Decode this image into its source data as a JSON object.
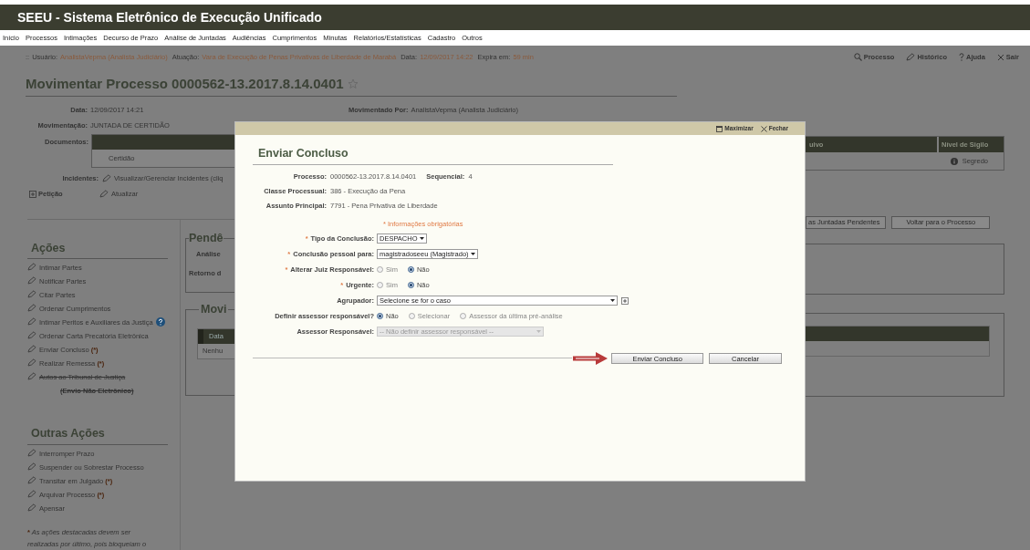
{
  "app_title": "SEEU - Sistema Eletrônico de Execução Unificado",
  "nav_menu": [
    "Início",
    "Processos",
    "Intimações",
    "Decurso de Prazo",
    "Análise de Juntadas",
    "Audiências",
    "Cumprimentos",
    "Minutas",
    "Relatórios/Estatísticas",
    "Cadastro",
    "Outros"
  ],
  "session": {
    "prefix": "::",
    "user_label": "Usuário:",
    "user": "AnalistaVepma (Analista Judiciário)",
    "role_label": "Atuação:",
    "role": "Vara de Execução de Penas Privativas de Liberdade de Marabá",
    "date_label": "Data:",
    "date": "12/09/2017 14:22",
    "expires_label": "Expira em:",
    "expires": "59 min"
  },
  "top_links": [
    {
      "kind": "search",
      "label": "Processo"
    },
    {
      "kind": "pencil",
      "label": "Histórico"
    },
    {
      "kind": "help",
      "label": "Ajuda"
    },
    {
      "kind": "close",
      "label": "Sair"
    }
  ],
  "page_title": "Movimentar Processo 0000562-13.2017.8.14.0401",
  "details": {
    "date_label": "Data:",
    "date": "12/09/2017 14:21",
    "moved_by_label": "Movimentado Por:",
    "moved_by": "AnalistaVepma (Analista Judiciário)",
    "movement_label": "Movimentação:",
    "movement": "JUNTADA DE CERTIDÃO"
  },
  "documents": {
    "label": "Documentos:",
    "rows": [
      "Certidão"
    ],
    "right_headers": [
      "uivo",
      "Nível de Sigilo"
    ],
    "right_rows": [
      "Segredo"
    ]
  },
  "incidents": {
    "label": "Incidentes:",
    "link": "Visualizar/Gerenciar Incidentes (cliq"
  },
  "petition": {
    "label": "Petição",
    "link": "Atualizar"
  },
  "right_buttons": [
    "as Juntadas Pendentes",
    "Voltar para o Processo"
  ],
  "actions": {
    "title": "Ações",
    "items": [
      {
        "label": "Intimar Partes",
        "help": false,
        "struck": false
      },
      {
        "label": "Notificar Partes",
        "help": false,
        "struck": false
      },
      {
        "label": "Citar Partes",
        "help": false,
        "struck": false
      },
      {
        "label": "Ordenar Cumprimentos",
        "help": false,
        "struck": false
      },
      {
        "label": "Intimar Peritos e Auxiliares da Justiça",
        "help": true,
        "struck": false
      },
      {
        "label": "Ordenar Carta Precatória Eletrônica",
        "help": false,
        "struck": false
      },
      {
        "label": "Enviar Concluso",
        "marker": "(*)",
        "help": false,
        "struck": false
      },
      {
        "label": "Realizar Remessa",
        "marker": "(*)",
        "help": false,
        "struck": false
      },
      {
        "label": "Autos ao Tribunal de Justiça",
        "note": "(Envio Não Eletrônico)",
        "help": false,
        "struck": true
      }
    ]
  },
  "other_actions": {
    "title": "Outras Ações",
    "items": [
      {
        "label": "Interromper Prazo"
      },
      {
        "label": "Suspender ou Sobrestar Processo"
      },
      {
        "label": "Transitar em Julgado",
        "marker": "(*)"
      },
      {
        "label": "Arquivar Processo",
        "marker": "(*)"
      },
      {
        "label": "Apensar"
      }
    ],
    "footnote_marker": "*",
    "footnote": "As ações destacadas devem ser",
    "footnote_2": "realizadas por último, pois bloqueiam o"
  },
  "pending": {
    "title": "Pendê",
    "rows": [
      "Análise",
      "Retorno d"
    ]
  },
  "movements": {
    "title": "Movi",
    "header": "Data",
    "empty": "Nenhu"
  },
  "dialog": {
    "header_buttons": [
      {
        "kind": "maximize",
        "label": "Maximizar"
      },
      {
        "kind": "close",
        "label": "Fechar"
      }
    ],
    "title": "Enviar Concluso",
    "info": [
      {
        "label": "Processo:",
        "value": "0000562-13.2017.8.14.0401",
        "extra_label": "Sequencial:",
        "extra_value": "4"
      },
      {
        "label": "Classe Processual:",
        "value": "386 - Execução da Pena"
      },
      {
        "label": "Assunto Principal:",
        "value": "7791 - Pena Privativa de Liberdade"
      }
    ],
    "required_note": "* Informações obrigatórias",
    "fields": [
      {
        "kind": "select",
        "marker": "*",
        "label": "Tipo da Conclusão:",
        "value": "DESPACHO",
        "disabled": false
      },
      {
        "kind": "select",
        "marker": "*",
        "label": "Conclusão pessoal para:",
        "value": "magistradoseeu (Magistrado)",
        "disabled": false
      },
      {
        "kind": "radio",
        "marker": "*",
        "label": "Alterar Juiz Responsável:",
        "options": [
          {
            "label": "Sim",
            "selected": false
          },
          {
            "label": "Não",
            "selected": true
          }
        ]
      },
      {
        "kind": "radio",
        "marker": "*",
        "label": "Urgente:",
        "options": [
          {
            "label": "Sim",
            "selected": false
          },
          {
            "label": "Não",
            "selected": true
          }
        ]
      },
      {
        "kind": "select_add",
        "label": "Agrupador:",
        "value": "Selecione se for o caso",
        "disabled": false
      },
      {
        "kind": "radio",
        "label": "Definir assessor responsável?",
        "options": [
          {
            "label": "Não",
            "selected": true
          },
          {
            "label": "Selecionar",
            "selected": false
          },
          {
            "label": "Assessor da última pré-análise",
            "selected": false
          }
        ]
      },
      {
        "kind": "select",
        "label": "Assessor Responsável:",
        "value": "-- Não definir assessor responsável --",
        "disabled": true
      }
    ],
    "buttons": [
      {
        "label": "Enviar Concluso"
      },
      {
        "label": "Cancelar"
      }
    ]
  }
}
